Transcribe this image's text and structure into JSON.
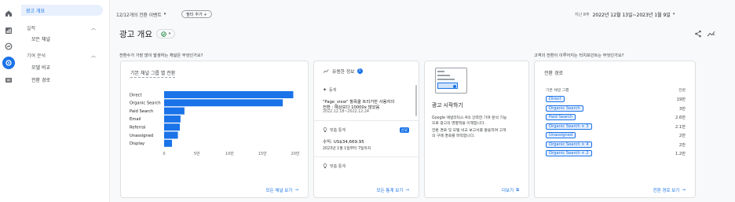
{
  "rail": {
    "items": [
      {
        "icon": "home-icon"
      },
      {
        "icon": "reports-icon"
      },
      {
        "icon": "explore-icon"
      },
      {
        "icon": "advertising-icon"
      },
      {
        "icon": "configure-icon"
      }
    ]
  },
  "nav": {
    "ads_overview": "광고 개요",
    "performance": "실적",
    "all_channels": "모든 채널",
    "attribution": "기여 분석",
    "model_comparison": "모델 비교",
    "conversion_paths": "전환 경로"
  },
  "header": {
    "conversion_events": "12/12개의 전환 이벤트",
    "add_filter": "필터 추가 +",
    "date_prefix": "지난 8주",
    "date_range": "2022년 12월 13일~2023년 1월 9일"
  },
  "page_title": "광고 개요",
  "channel_card": {
    "question": "전환수가 가장 많이 발생하는 채널은 무엇인가요?",
    "title": "기본 채널 그룹 별 전환",
    "link": "모든 채널 보기"
  },
  "chart_data": {
    "type": "bar",
    "orientation": "horizontal",
    "title": "기본 채널 그룹 별 전환",
    "categories": [
      "Direct",
      "Organic Search",
      "Paid Search",
      "Email",
      "Referral",
      "Unassigned",
      "Display"
    ],
    "values": [
      197000,
      181000,
      31000,
      25000,
      24000,
      21000,
      12000
    ],
    "xticks": [
      "0",
      "5만",
      "10만",
      "15만",
      "20만"
    ],
    "xlim": [
      0,
      200000
    ]
  },
  "insights_card": {
    "title": "유용한 정보",
    "count": "1",
    "item1_label": "동계",
    "item1_text_1": "\"Page_view\" 항목을 트리거한 사용자의",
    "item1_text_2": "전환 : 예상보다 10000x 많았음",
    "item1_date": "2022.12.18~2022.12.24",
    "item2_label": "맞춤 통계",
    "item2_badge": "신규",
    "item2_value": "수익: US$34,669.95",
    "item2_desc": "2023년 1월 1일부터 7일까지",
    "item3_label": "맞춤 통계",
    "link": "모든 통계 보기"
  },
  "start_card": {
    "title": "광고 시작하기",
    "desc1": "Google 애널리틱스 4의 강력한 기여 분석 기능",
    "desc2": "으로 광고의 영향력을 이해합니다.",
    "desc3": "전환 경로 및 모델 비교 보고서를 활용하여 고객",
    "desc4": "의 구매 경로를 파악합니다.",
    "link": "더보기"
  },
  "paths_card": {
    "question": "고객의 전환이 이루어지는 터치포인트는 무엇인가요?",
    "title": "전환 경로",
    "col_left": "기본 채널 그룹",
    "col_right": "전환",
    "rows": [
      {
        "path": "Direct",
        "value": "19만"
      },
      {
        "path": "Organic Search",
        "value": "3만"
      },
      {
        "path": "Paid Search",
        "value": "2.6만"
      },
      {
        "path": "Organic Search × 3",
        "value": "2.1만"
      },
      {
        "path": "Unassigned",
        "value": "2만"
      },
      {
        "path": "Organic Search × 4",
        "value": "2만"
      },
      {
        "path": "Organic Search × 2",
        "value": "1.2만"
      }
    ],
    "link": "전환 경로 보기"
  },
  "colors": {
    "accent": "#1a73e8",
    "bar": "#1a73e8",
    "success": "#188038"
  }
}
